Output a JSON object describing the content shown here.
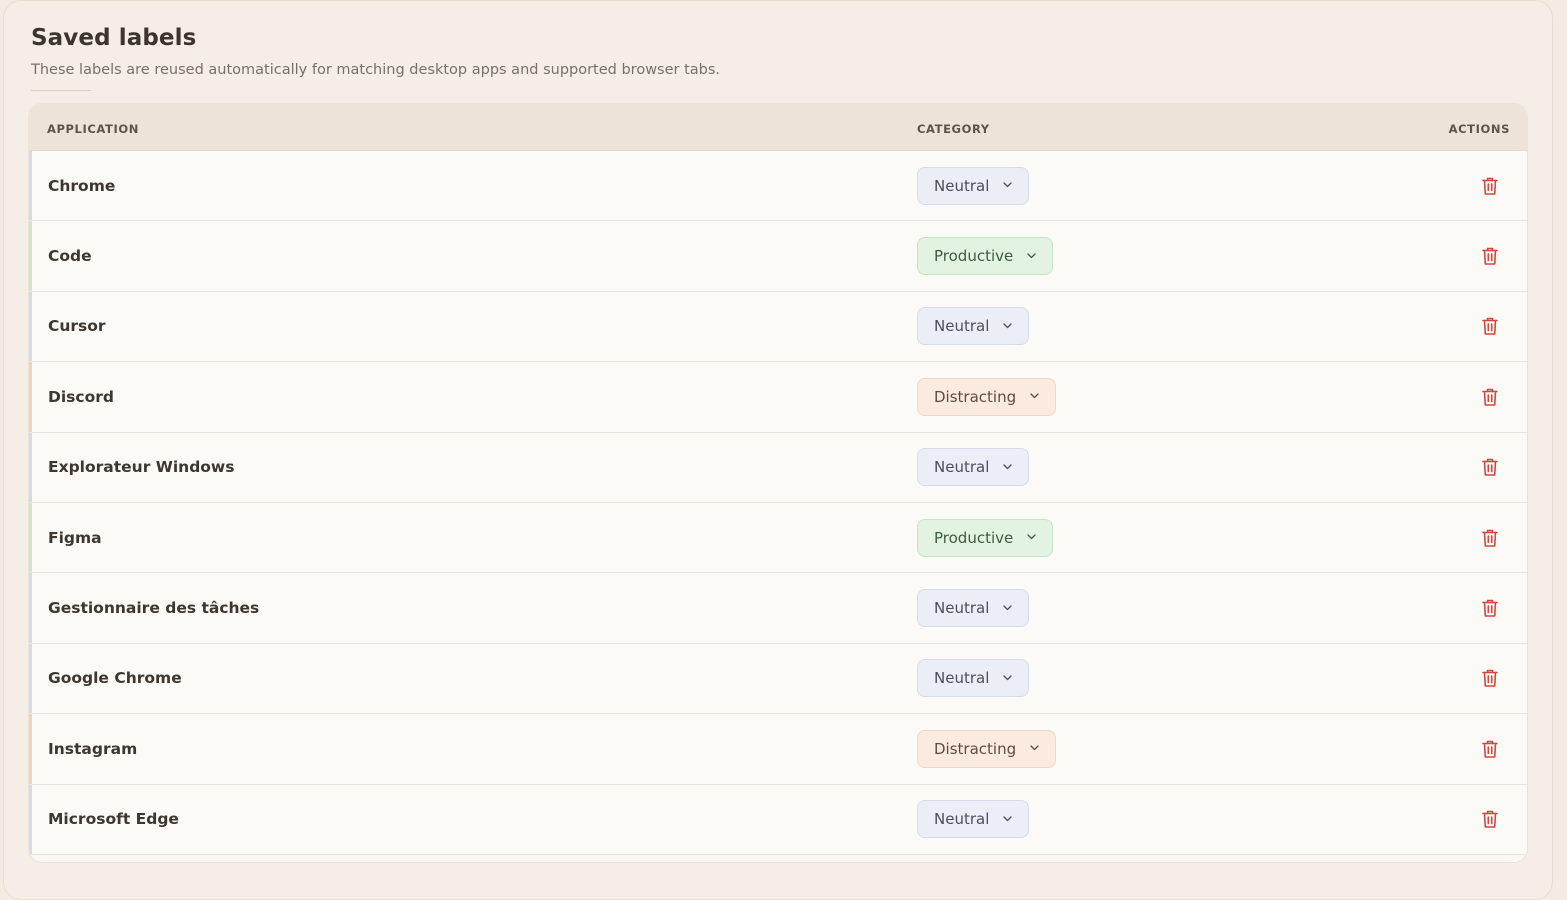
{
  "header": {
    "title": "Saved labels",
    "subtitle": "These labels are reused automatically for matching desktop apps and supported browser tabs."
  },
  "table": {
    "columns": {
      "application": "APPLICATION",
      "category": "CATEGORY",
      "actions": "ACTIONS"
    },
    "rows": [
      {
        "app": "Chrome",
        "category": "Neutral",
        "type": "neutral"
      },
      {
        "app": "Code",
        "category": "Productive",
        "type": "productive"
      },
      {
        "app": "Cursor",
        "category": "Neutral",
        "type": "neutral"
      },
      {
        "app": "Discord",
        "category": "Distracting",
        "type": "distracting"
      },
      {
        "app": "Explorateur Windows",
        "category": "Neutral",
        "type": "neutral"
      },
      {
        "app": "Figma",
        "category": "Productive",
        "type": "productive"
      },
      {
        "app": "Gestionnaire des tâches",
        "category": "Neutral",
        "type": "neutral"
      },
      {
        "app": "Google Chrome",
        "category": "Neutral",
        "type": "neutral"
      },
      {
        "app": "Instagram",
        "category": "Distracting",
        "type": "distracting"
      },
      {
        "app": "Microsoft Edge",
        "category": "Neutral",
        "type": "neutral"
      }
    ]
  },
  "icons": {
    "chevron": "chevron-down-icon",
    "delete": "trash-icon"
  },
  "colors": {
    "neutral_accent": "#d6dbe8",
    "productive_accent": "#cfe6cf",
    "distracting_accent": "#f0d3bf",
    "delete_icon": "#d0473f"
  }
}
